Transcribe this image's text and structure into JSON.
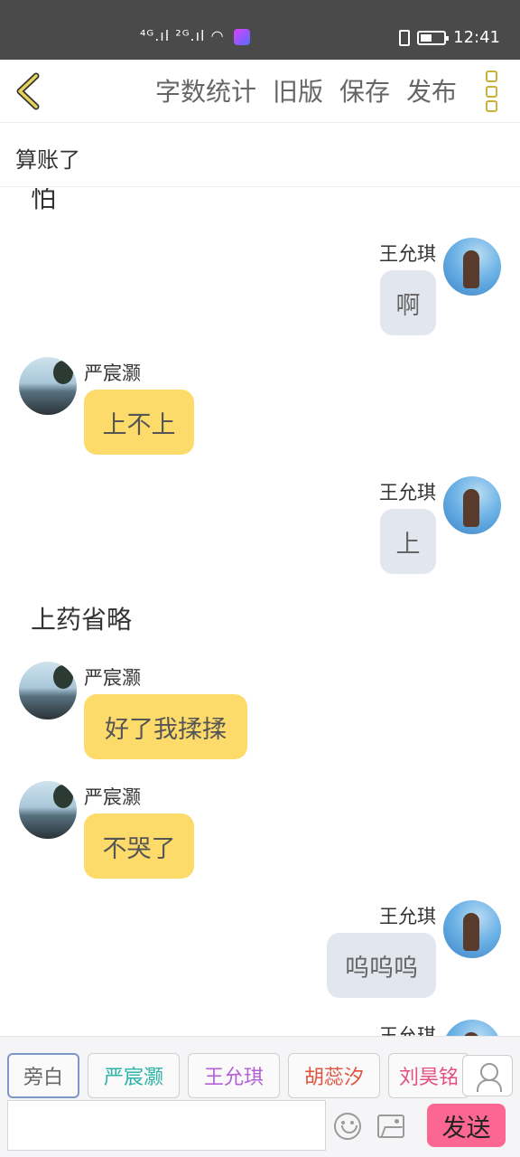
{
  "status_bar": {
    "signal_text": "⁴ᴳ.ıl ²ᴳ.ıl",
    "time": "12:41"
  },
  "toolbar": {
    "actions": [
      "字数统计",
      "旧版",
      "保存",
      "发布"
    ]
  },
  "chat_title": "算账了",
  "messages": [
    {
      "type": "narration",
      "text": "怕"
    },
    {
      "type": "chat",
      "side": "right",
      "name": "王允琪",
      "text": "啊"
    },
    {
      "type": "chat",
      "side": "left",
      "name": "严宸灏",
      "text": "上不上"
    },
    {
      "type": "chat",
      "side": "right",
      "name": "王允琪",
      "text": "上"
    },
    {
      "type": "narration",
      "text": "上药省略"
    },
    {
      "type": "chat",
      "side": "left",
      "name": "严宸灏",
      "text": "好了我揉揉"
    },
    {
      "type": "chat",
      "side": "left",
      "name": "严宸灏",
      "text": "不哭了"
    },
    {
      "type": "chat",
      "side": "right",
      "name": "王允琪",
      "text": "呜呜呜"
    },
    {
      "type": "chat",
      "side": "right",
      "name": "王允琪",
      "text": ""
    }
  ],
  "roles": [
    {
      "label": "旁白",
      "color": "#666666",
      "active": true
    },
    {
      "label": "严宸灏",
      "color": "#2bb3a8",
      "active": false
    },
    {
      "label": "王允琪",
      "color": "#b560d4",
      "active": false
    },
    {
      "label": "胡蕊汐",
      "color": "#e0533f",
      "active": false
    },
    {
      "label": "刘昊铭",
      "color": "#e2507f",
      "active": false
    }
  ],
  "input": {
    "value": "",
    "placeholder": ""
  },
  "send_label": "发送",
  "colors": {
    "accent_yellow": "#fddb6a",
    "send_pink": "#fb6790"
  }
}
